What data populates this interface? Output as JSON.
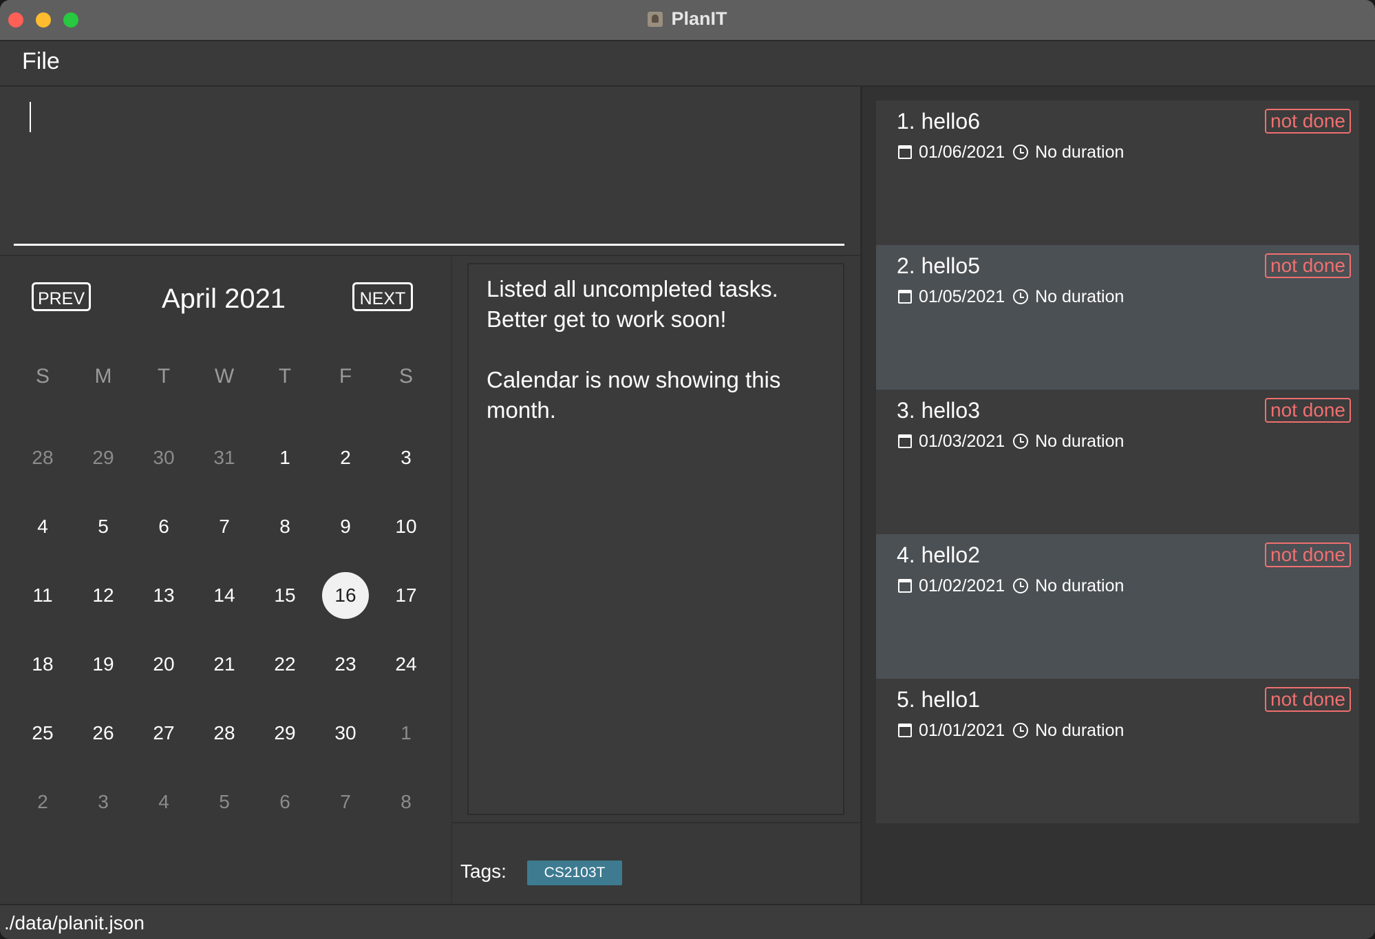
{
  "window": {
    "title": "PlanIT"
  },
  "menu": {
    "file": "File"
  },
  "command": {
    "value": ""
  },
  "calendar": {
    "prev_label": "PREV",
    "next_label": "NEXT",
    "month_title": "April 2021",
    "weekdays": [
      "S",
      "M",
      "T",
      "W",
      "T",
      "F",
      "S"
    ],
    "weeks": [
      [
        "28",
        "29",
        "30",
        "31",
        "1",
        "2",
        "3"
      ],
      [
        "4",
        "5",
        "6",
        "7",
        "8",
        "9",
        "10"
      ],
      [
        "11",
        "12",
        "13",
        "14",
        "15",
        "16",
        "17"
      ],
      [
        "18",
        "19",
        "20",
        "21",
        "22",
        "23",
        "24"
      ],
      [
        "25",
        "26",
        "27",
        "28",
        "29",
        "30",
        "1"
      ],
      [
        "2",
        "3",
        "4",
        "5",
        "6",
        "7",
        "8"
      ]
    ],
    "today": "16"
  },
  "result": {
    "line1": "Listed all uncompleted tasks.",
    "line2": "Better get to work soon!",
    "line3": "Calendar is now showing this",
    "line4": "month."
  },
  "tags": {
    "label": "Tags:",
    "items": [
      "CS2103T"
    ]
  },
  "tasks": [
    {
      "title": "1.  hello6",
      "date": "01/06/2021",
      "duration": "No duration",
      "status": "not done"
    },
    {
      "title": "2.  hello5",
      "date": "01/05/2021",
      "duration": "No duration",
      "status": "not done"
    },
    {
      "title": "3.  hello3",
      "date": "01/03/2021",
      "duration": "No duration",
      "status": "not done"
    },
    {
      "title": "4.  hello2",
      "date": "01/02/2021",
      "duration": "No duration",
      "status": "not done"
    },
    {
      "title": "5.  hello1",
      "date": "01/01/2021",
      "duration": "No duration",
      "status": "not done"
    }
  ],
  "statusbar": {
    "path": "./data/planit.json"
  },
  "colors": {
    "status_red": "#f07070",
    "tag_blue": "#3e7b91",
    "row_alt": "#4b5054"
  }
}
